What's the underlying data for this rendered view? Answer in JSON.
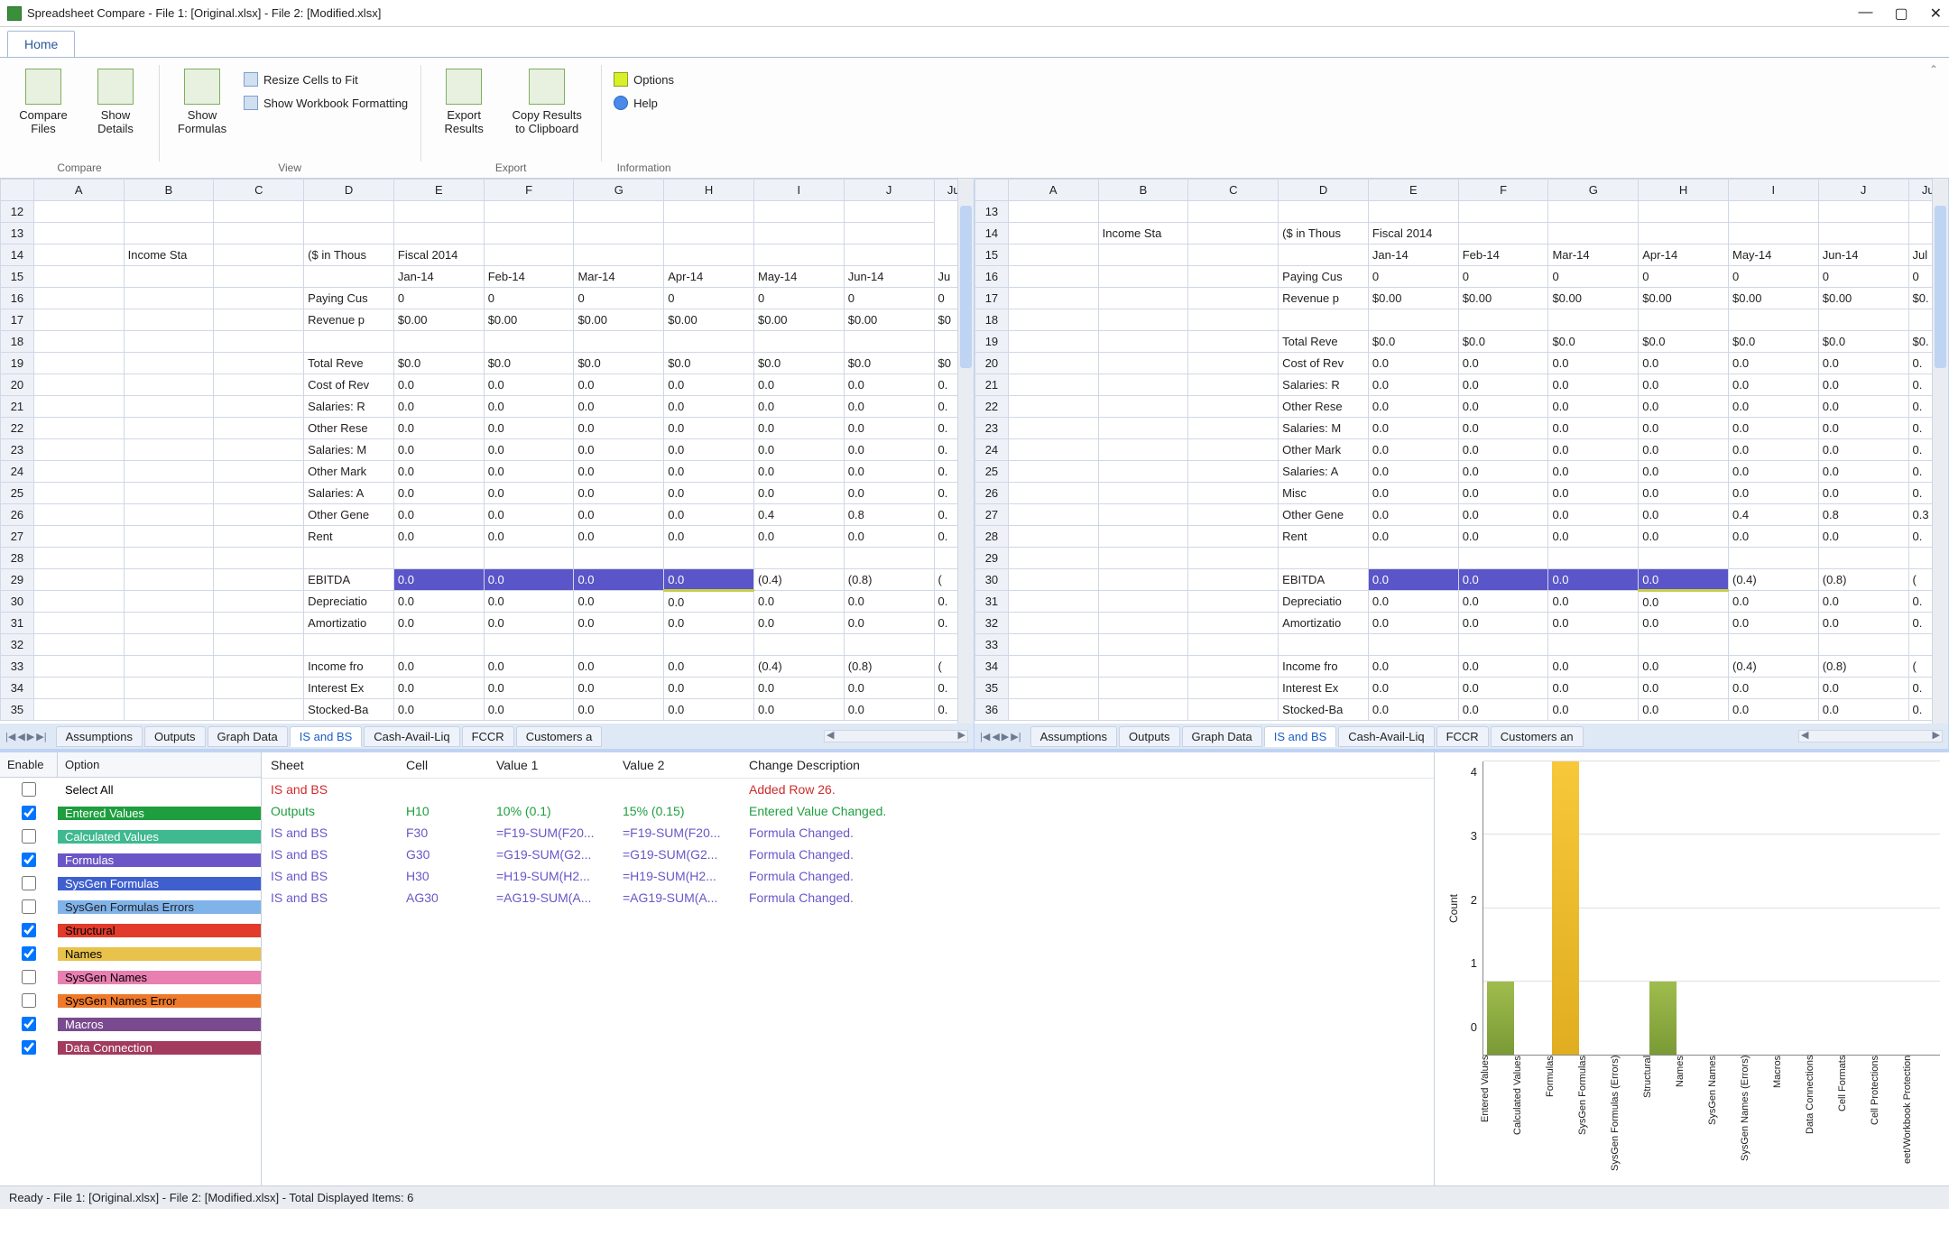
{
  "window": {
    "title": "Spreadsheet Compare - File 1: [Original.xlsx] - File 2: [Modified.xlsx]"
  },
  "ribbon_tab": "Home",
  "ribbon": {
    "compare": {
      "compare_files": "Compare\nFiles",
      "show_details": "Show\nDetails",
      "group": "Compare"
    },
    "view": {
      "show_formulas": "Show\nFormulas",
      "resize": "Resize Cells to Fit",
      "workbook_fmt": "Show Workbook Formatting",
      "group": "View"
    },
    "export": {
      "export_results": "Export\nResults",
      "copy_clip": "Copy Results\nto Clipboard",
      "group": "Export"
    },
    "info": {
      "options": "Options",
      "help": "Help",
      "group": "Information"
    }
  },
  "columns": [
    "A",
    "B",
    "C",
    "D",
    "E",
    "F",
    "G",
    "H",
    "I",
    "J",
    "Ju"
  ],
  "left_grid": {
    "start_row": 12,
    "rows": [
      {
        "r": 12,
        "cells": [
          "",
          "",
          "",
          "",
          "",
          "",
          "",
          "",
          "",
          ""
        ]
      },
      {
        "r": 13,
        "cells": [
          "",
          "",
          "",
          "",
          "",
          "",
          "",
          "",
          "",
          ""
        ]
      },
      {
        "r": 14,
        "cells": [
          "",
          "Income Sta",
          "",
          "($ in Thous",
          "Fiscal 2014",
          "",
          "",
          "",
          "",
          "",
          ""
        ]
      },
      {
        "r": 15,
        "cells": [
          "",
          "",
          "",
          "",
          "Jan-14",
          "Feb-14",
          "Mar-14",
          "Apr-14",
          "May-14",
          "Jun-14",
          "Ju"
        ]
      },
      {
        "r": 16,
        "cells": [
          "",
          "",
          "",
          "Paying Cus",
          "0",
          "0",
          "0",
          "0",
          "0",
          "0",
          "0"
        ]
      },
      {
        "r": 17,
        "cells": [
          "",
          "",
          "",
          "Revenue p",
          "$0.00",
          "$0.00",
          "$0.00",
          "$0.00",
          "$0.00",
          "$0.00",
          "$0"
        ]
      },
      {
        "r": 18,
        "cells": [
          "",
          "",
          "",
          "",
          "",
          "",
          "",
          "",
          "",
          "",
          ""
        ]
      },
      {
        "r": 19,
        "cells": [
          "",
          "",
          "",
          "Total Reve",
          "$0.0",
          "$0.0",
          "$0.0",
          "$0.0",
          "$0.0",
          "$0.0",
          "$0"
        ]
      },
      {
        "r": 20,
        "cells": [
          "",
          "",
          "",
          "Cost of Rev",
          "0.0",
          "0.0",
          "0.0",
          "0.0",
          "0.0",
          "0.0",
          "0."
        ]
      },
      {
        "r": 21,
        "cells": [
          "",
          "",
          "",
          "Salaries: R",
          "0.0",
          "0.0",
          "0.0",
          "0.0",
          "0.0",
          "0.0",
          "0."
        ]
      },
      {
        "r": 22,
        "cells": [
          "",
          "",
          "",
          "Other Rese",
          "0.0",
          "0.0",
          "0.0",
          "0.0",
          "0.0",
          "0.0",
          "0."
        ]
      },
      {
        "r": 23,
        "cells": [
          "",
          "",
          "",
          "Salaries: M",
          "0.0",
          "0.0",
          "0.0",
          "0.0",
          "0.0",
          "0.0",
          "0."
        ]
      },
      {
        "r": 24,
        "cells": [
          "",
          "",
          "",
          "Other Mark",
          "0.0",
          "0.0",
          "0.0",
          "0.0",
          "0.0",
          "0.0",
          "0."
        ]
      },
      {
        "r": 25,
        "cells": [
          "",
          "",
          "",
          "Salaries: A",
          "0.0",
          "0.0",
          "0.0",
          "0.0",
          "0.0",
          "0.0",
          "0."
        ]
      },
      {
        "r": 26,
        "cells": [
          "",
          "",
          "",
          "Other Gene",
          "0.0",
          "0.0",
          "0.0",
          "0.0",
          "0.4",
          "0.8",
          "0."
        ]
      },
      {
        "r": 27,
        "cells": [
          "",
          "",
          "",
          "Rent",
          "0.0",
          "0.0",
          "0.0",
          "0.0",
          "0.0",
          "0.0",
          "0."
        ]
      },
      {
        "r": 28,
        "cells": [
          "",
          "",
          "",
          "",
          "",
          "",
          "",
          "",
          "",
          "",
          ""
        ]
      },
      {
        "r": 29,
        "cells": [
          "",
          "",
          "",
          "EBITDA",
          "0.0",
          "0.0",
          "0.0",
          "0.0",
          "(0.4)",
          "(0.8)",
          "("
        ],
        "hl": "purple",
        "hlcols": [
          4,
          5,
          6
        ],
        "lime": 7
      },
      {
        "r": 30,
        "cells": [
          "",
          "",
          "",
          "Depreciatio",
          "0.0",
          "0.0",
          "0.0",
          "0.0",
          "0.0",
          "0.0",
          "0."
        ]
      },
      {
        "r": 31,
        "cells": [
          "",
          "",
          "",
          "Amortizatio",
          "0.0",
          "0.0",
          "0.0",
          "0.0",
          "0.0",
          "0.0",
          "0."
        ]
      },
      {
        "r": 32,
        "cells": [
          "",
          "",
          "",
          "",
          "",
          "",
          "",
          "",
          "",
          "",
          ""
        ]
      },
      {
        "r": 33,
        "cells": [
          "",
          "",
          "",
          "Income fro",
          "0.0",
          "0.0",
          "0.0",
          "0.0",
          "(0.4)",
          "(0.8)",
          "("
        ]
      },
      {
        "r": 34,
        "cells": [
          "",
          "",
          "",
          "Interest Ex",
          "0.0",
          "0.0",
          "0.0",
          "0.0",
          "0.0",
          "0.0",
          "0."
        ]
      },
      {
        "r": 35,
        "cells": [
          "",
          "",
          "",
          "Stocked-Ba",
          "0.0",
          "0.0",
          "0.0",
          "0.0",
          "0.0",
          "0.0",
          "0."
        ]
      }
    ]
  },
  "right_grid": {
    "start_row": 13,
    "rows": [
      {
        "r": 13,
        "cells": [
          "",
          "",
          "",
          "",
          "",
          "",
          "",
          "",
          "",
          ""
        ]
      },
      {
        "r": 14,
        "cells": [
          "",
          "Income Sta",
          "",
          "($ in Thous",
          "Fiscal 2014",
          "",
          "",
          "",
          "",
          "",
          ""
        ]
      },
      {
        "r": 15,
        "cells": [
          "",
          "",
          "",
          "",
          "Jan-14",
          "Feb-14",
          "Mar-14",
          "Apr-14",
          "May-14",
          "Jun-14",
          "Jul"
        ]
      },
      {
        "r": 16,
        "cells": [
          "",
          "",
          "",
          "Paying Cus",
          "0",
          "0",
          "0",
          "0",
          "0",
          "0",
          "0"
        ]
      },
      {
        "r": 17,
        "cells": [
          "",
          "",
          "",
          "Revenue p",
          "$0.00",
          "$0.00",
          "$0.00",
          "$0.00",
          "$0.00",
          "$0.00",
          "$0."
        ]
      },
      {
        "r": 18,
        "cells": [
          "",
          "",
          "",
          "",
          "",
          "",
          "",
          "",
          "",
          "",
          ""
        ]
      },
      {
        "r": 19,
        "cells": [
          "",
          "",
          "",
          "Total Reve",
          "$0.0",
          "$0.0",
          "$0.0",
          "$0.0",
          "$0.0",
          "$0.0",
          "$0."
        ]
      },
      {
        "r": 20,
        "cells": [
          "",
          "",
          "",
          "Cost of Rev",
          "0.0",
          "0.0",
          "0.0",
          "0.0",
          "0.0",
          "0.0",
          "0."
        ]
      },
      {
        "r": 21,
        "cells": [
          "",
          "",
          "",
          "Salaries: R",
          "0.0",
          "0.0",
          "0.0",
          "0.0",
          "0.0",
          "0.0",
          "0."
        ]
      },
      {
        "r": 22,
        "cells": [
          "",
          "",
          "",
          "Other Rese",
          "0.0",
          "0.0",
          "0.0",
          "0.0",
          "0.0",
          "0.0",
          "0."
        ]
      },
      {
        "r": 23,
        "cells": [
          "",
          "",
          "",
          "Salaries: M",
          "0.0",
          "0.0",
          "0.0",
          "0.0",
          "0.0",
          "0.0",
          "0."
        ]
      },
      {
        "r": 24,
        "cells": [
          "",
          "",
          "",
          "Other Mark",
          "0.0",
          "0.0",
          "0.0",
          "0.0",
          "0.0",
          "0.0",
          "0."
        ]
      },
      {
        "r": 25,
        "cells": [
          "",
          "",
          "",
          "Salaries: A",
          "0.0",
          "0.0",
          "0.0",
          "0.0",
          "0.0",
          "0.0",
          "0."
        ]
      },
      {
        "r": 26,
        "cells": [
          "",
          "",
          "",
          "Misc",
          "0.0",
          "0.0",
          "0.0",
          "0.0",
          "0.0",
          "0.0",
          "0."
        ]
      },
      {
        "r": 27,
        "cells": [
          "",
          "",
          "",
          "Other Gene",
          "0.0",
          "0.0",
          "0.0",
          "0.0",
          "0.4",
          "0.8",
          "0.3"
        ]
      },
      {
        "r": 28,
        "cells": [
          "",
          "",
          "",
          "Rent",
          "0.0",
          "0.0",
          "0.0",
          "0.0",
          "0.0",
          "0.0",
          "0."
        ]
      },
      {
        "r": 29,
        "cells": [
          "",
          "",
          "",
          "",
          "",
          "",
          "",
          "",
          "",
          "",
          ""
        ]
      },
      {
        "r": 30,
        "cells": [
          "",
          "",
          "",
          "EBITDA",
          "0.0",
          "0.0",
          "0.0",
          "0.0",
          "(0.4)",
          "(0.8)",
          "("
        ],
        "hl": "purple",
        "hlcols": [
          4,
          5,
          6
        ],
        "lime": 7
      },
      {
        "r": 31,
        "cells": [
          "",
          "",
          "",
          "Depreciatio",
          "0.0",
          "0.0",
          "0.0",
          "0.0",
          "0.0",
          "0.0",
          "0."
        ]
      },
      {
        "r": 32,
        "cells": [
          "",
          "",
          "",
          "Amortizatio",
          "0.0",
          "0.0",
          "0.0",
          "0.0",
          "0.0",
          "0.0",
          "0."
        ]
      },
      {
        "r": 33,
        "cells": [
          "",
          "",
          "",
          "",
          "",
          "",
          "",
          "",
          "",
          "",
          ""
        ]
      },
      {
        "r": 34,
        "cells": [
          "",
          "",
          "",
          "Income fro",
          "0.0",
          "0.0",
          "0.0",
          "0.0",
          "(0.4)",
          "(0.8)",
          "("
        ]
      },
      {
        "r": 35,
        "cells": [
          "",
          "",
          "",
          "Interest Ex",
          "0.0",
          "0.0",
          "0.0",
          "0.0",
          "0.0",
          "0.0",
          "0."
        ]
      },
      {
        "r": 36,
        "cells": [
          "",
          "",
          "",
          "Stocked-Ba",
          "0.0",
          "0.0",
          "0.0",
          "0.0",
          "0.0",
          "0.0",
          "0."
        ]
      }
    ]
  },
  "sheet_tabs": [
    "Assumptions",
    "Outputs",
    "Graph Data",
    "IS and BS",
    "Cash-Avail-Liq",
    "FCCR",
    "Customers a"
  ],
  "sheet_tabs_right": [
    "Assumptions",
    "Outputs",
    "Graph Data",
    "IS and BS",
    "Cash-Avail-Liq",
    "FCCR",
    "Customers an"
  ],
  "active_tab": "IS and BS",
  "options_header": {
    "enable": "Enable",
    "option": "Option"
  },
  "options": [
    {
      "label": "Select All",
      "checked": false,
      "bg": "#ffffff",
      "fg": "#000"
    },
    {
      "label": "Entered Values",
      "checked": true,
      "bg": "#1e9e3f",
      "fg": "#fff"
    },
    {
      "label": "Calculated Values",
      "checked": false,
      "bg": "#3fb98f",
      "fg": "#fff"
    },
    {
      "label": "Formulas",
      "checked": true,
      "bg": "#6b56c8",
      "fg": "#fff"
    },
    {
      "label": "SysGen Formulas",
      "checked": false,
      "bg": "#3f5fcf",
      "fg": "#fff"
    },
    {
      "label": "SysGen Formulas Errors",
      "checked": false,
      "bg": "#7fb3ea",
      "fg": "#222"
    },
    {
      "label": "Structural",
      "checked": true,
      "bg": "#e23b2b",
      "fg": "#000"
    },
    {
      "label": "Names",
      "checked": true,
      "bg": "#e8c24b",
      "fg": "#000"
    },
    {
      "label": "SysGen Names",
      "checked": false,
      "bg": "#e87fb0",
      "fg": "#000"
    },
    {
      "label": "SysGen Names Error",
      "checked": false,
      "bg": "#ef792b",
      "fg": "#000"
    },
    {
      "label": "Macros",
      "checked": true,
      "bg": "#7a4a8f",
      "fg": "#fff"
    },
    {
      "label": "Data Connection",
      "checked": true,
      "bg": "#a33b5f",
      "fg": "#fff"
    }
  ],
  "diff_headers": [
    "Sheet",
    "Cell",
    "Value 1",
    "Value 2",
    "Change Description"
  ],
  "diffs": [
    {
      "sheet": "IS and BS",
      "cell": "",
      "v1": "",
      "v2": "",
      "desc": "Added Row 26.",
      "color": "#d02a2a"
    },
    {
      "sheet": "Outputs",
      "cell": "H10",
      "v1": "10% (0.1)",
      "v2": "15% (0.15)",
      "desc": "Entered Value Changed.",
      "color": "#1e9e3f"
    },
    {
      "sheet": "IS and BS",
      "cell": "F30",
      "v1": "=F19-SUM(F20...",
      "v2": "=F19-SUM(F20...",
      "desc": "Formula Changed.",
      "color": "#6b56c8"
    },
    {
      "sheet": "IS and BS",
      "cell": "G30",
      "v1": "=G19-SUM(G2...",
      "v2": "=G19-SUM(G2...",
      "desc": "Formula Changed.",
      "color": "#6b56c8"
    },
    {
      "sheet": "IS and BS",
      "cell": "H30",
      "v1": "=H19-SUM(H2...",
      "v2": "=H19-SUM(H2...",
      "desc": "Formula Changed.",
      "color": "#6b56c8"
    },
    {
      "sheet": "IS and BS",
      "cell": "AG30",
      "v1": "=AG19-SUM(A...",
      "v2": "=AG19-SUM(A...",
      "desc": "Formula Changed.",
      "color": "#6b56c8"
    }
  ],
  "chart_data": {
    "type": "bar",
    "ylabel": "Count",
    "ylim": [
      0,
      4
    ],
    "categories": [
      "Entered Values",
      "Calculated Values",
      "Formulas",
      "SysGen Formulas",
      "SysGen Formulas (Errors)",
      "Structural",
      "Names",
      "SysGen Names",
      "SysGen Names (Errors)",
      "Macros",
      "Data Connections",
      "Cell Formats",
      "Cell Protections",
      "eet/Workbook Protection"
    ],
    "values": [
      1,
      0,
      4,
      0,
      0,
      1,
      0,
      0,
      0,
      0,
      0,
      0,
      0,
      0
    ],
    "colors": [
      "green",
      "",
      "yellow",
      "",
      "",
      "green",
      "",
      "",
      "",
      "",
      "",
      "",
      "",
      ""
    ]
  },
  "statusbar": "Ready - File 1: [Original.xlsx] - File 2: [Modified.xlsx] - Total Displayed Items: 6"
}
